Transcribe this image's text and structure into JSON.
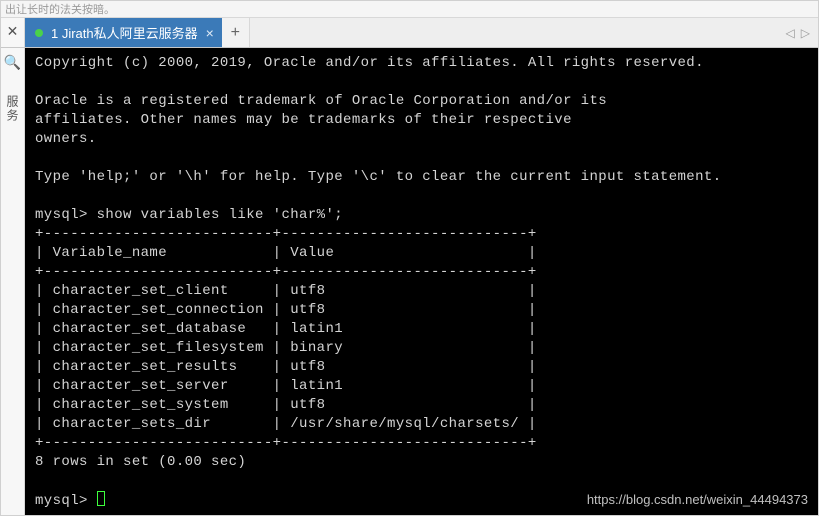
{
  "top_fragment": "出让长时的法关按暗。",
  "tabbar": {
    "close_x": "✕",
    "tab_label": "1 Jirath私人阿里云服务器",
    "tab_close": "×",
    "new_tab": "+",
    "nav_prev": "◁",
    "nav_next": "▷"
  },
  "sidebar": {
    "search_icon": "🔍",
    "vertical_label": "服务"
  },
  "terminal": {
    "copyright": "Copyright (c) 2000, 2019, Oracle and/or its affiliates. All rights reserved.",
    "trademark1": "Oracle is a registered trademark of Oracle Corporation and/or its",
    "trademark2": "affiliates. Other names may be trademarks of their respective",
    "trademark3": "owners.",
    "help_hint": "Type 'help;' or '\\h' for help. Type '\\c' to clear the current input statement.",
    "prompt1": "mysql> show variables like 'char%';",
    "border_top": "+--------------------------+----------------------------+",
    "header_row": "| Variable_name            | Value                      |",
    "border_mid": "+--------------------------+----------------------------+",
    "rows": [
      "| character_set_client     | utf8                       |",
      "| character_set_connection | utf8                       |",
      "| character_set_database   | latin1                     |",
      "| character_set_filesystem | binary                     |",
      "| character_set_results    | utf8                       |",
      "| character_set_server     | latin1                     |",
      "| character_set_system     | utf8                       |",
      "| character_sets_dir       | /usr/share/mysql/charsets/ |"
    ],
    "border_bot": "+--------------------------+----------------------------+",
    "summary": "8 rows in set (0.00 sec)",
    "prompt2": "mysql> "
  },
  "watermark": "https://blog.csdn.net/weixin_44494373"
}
